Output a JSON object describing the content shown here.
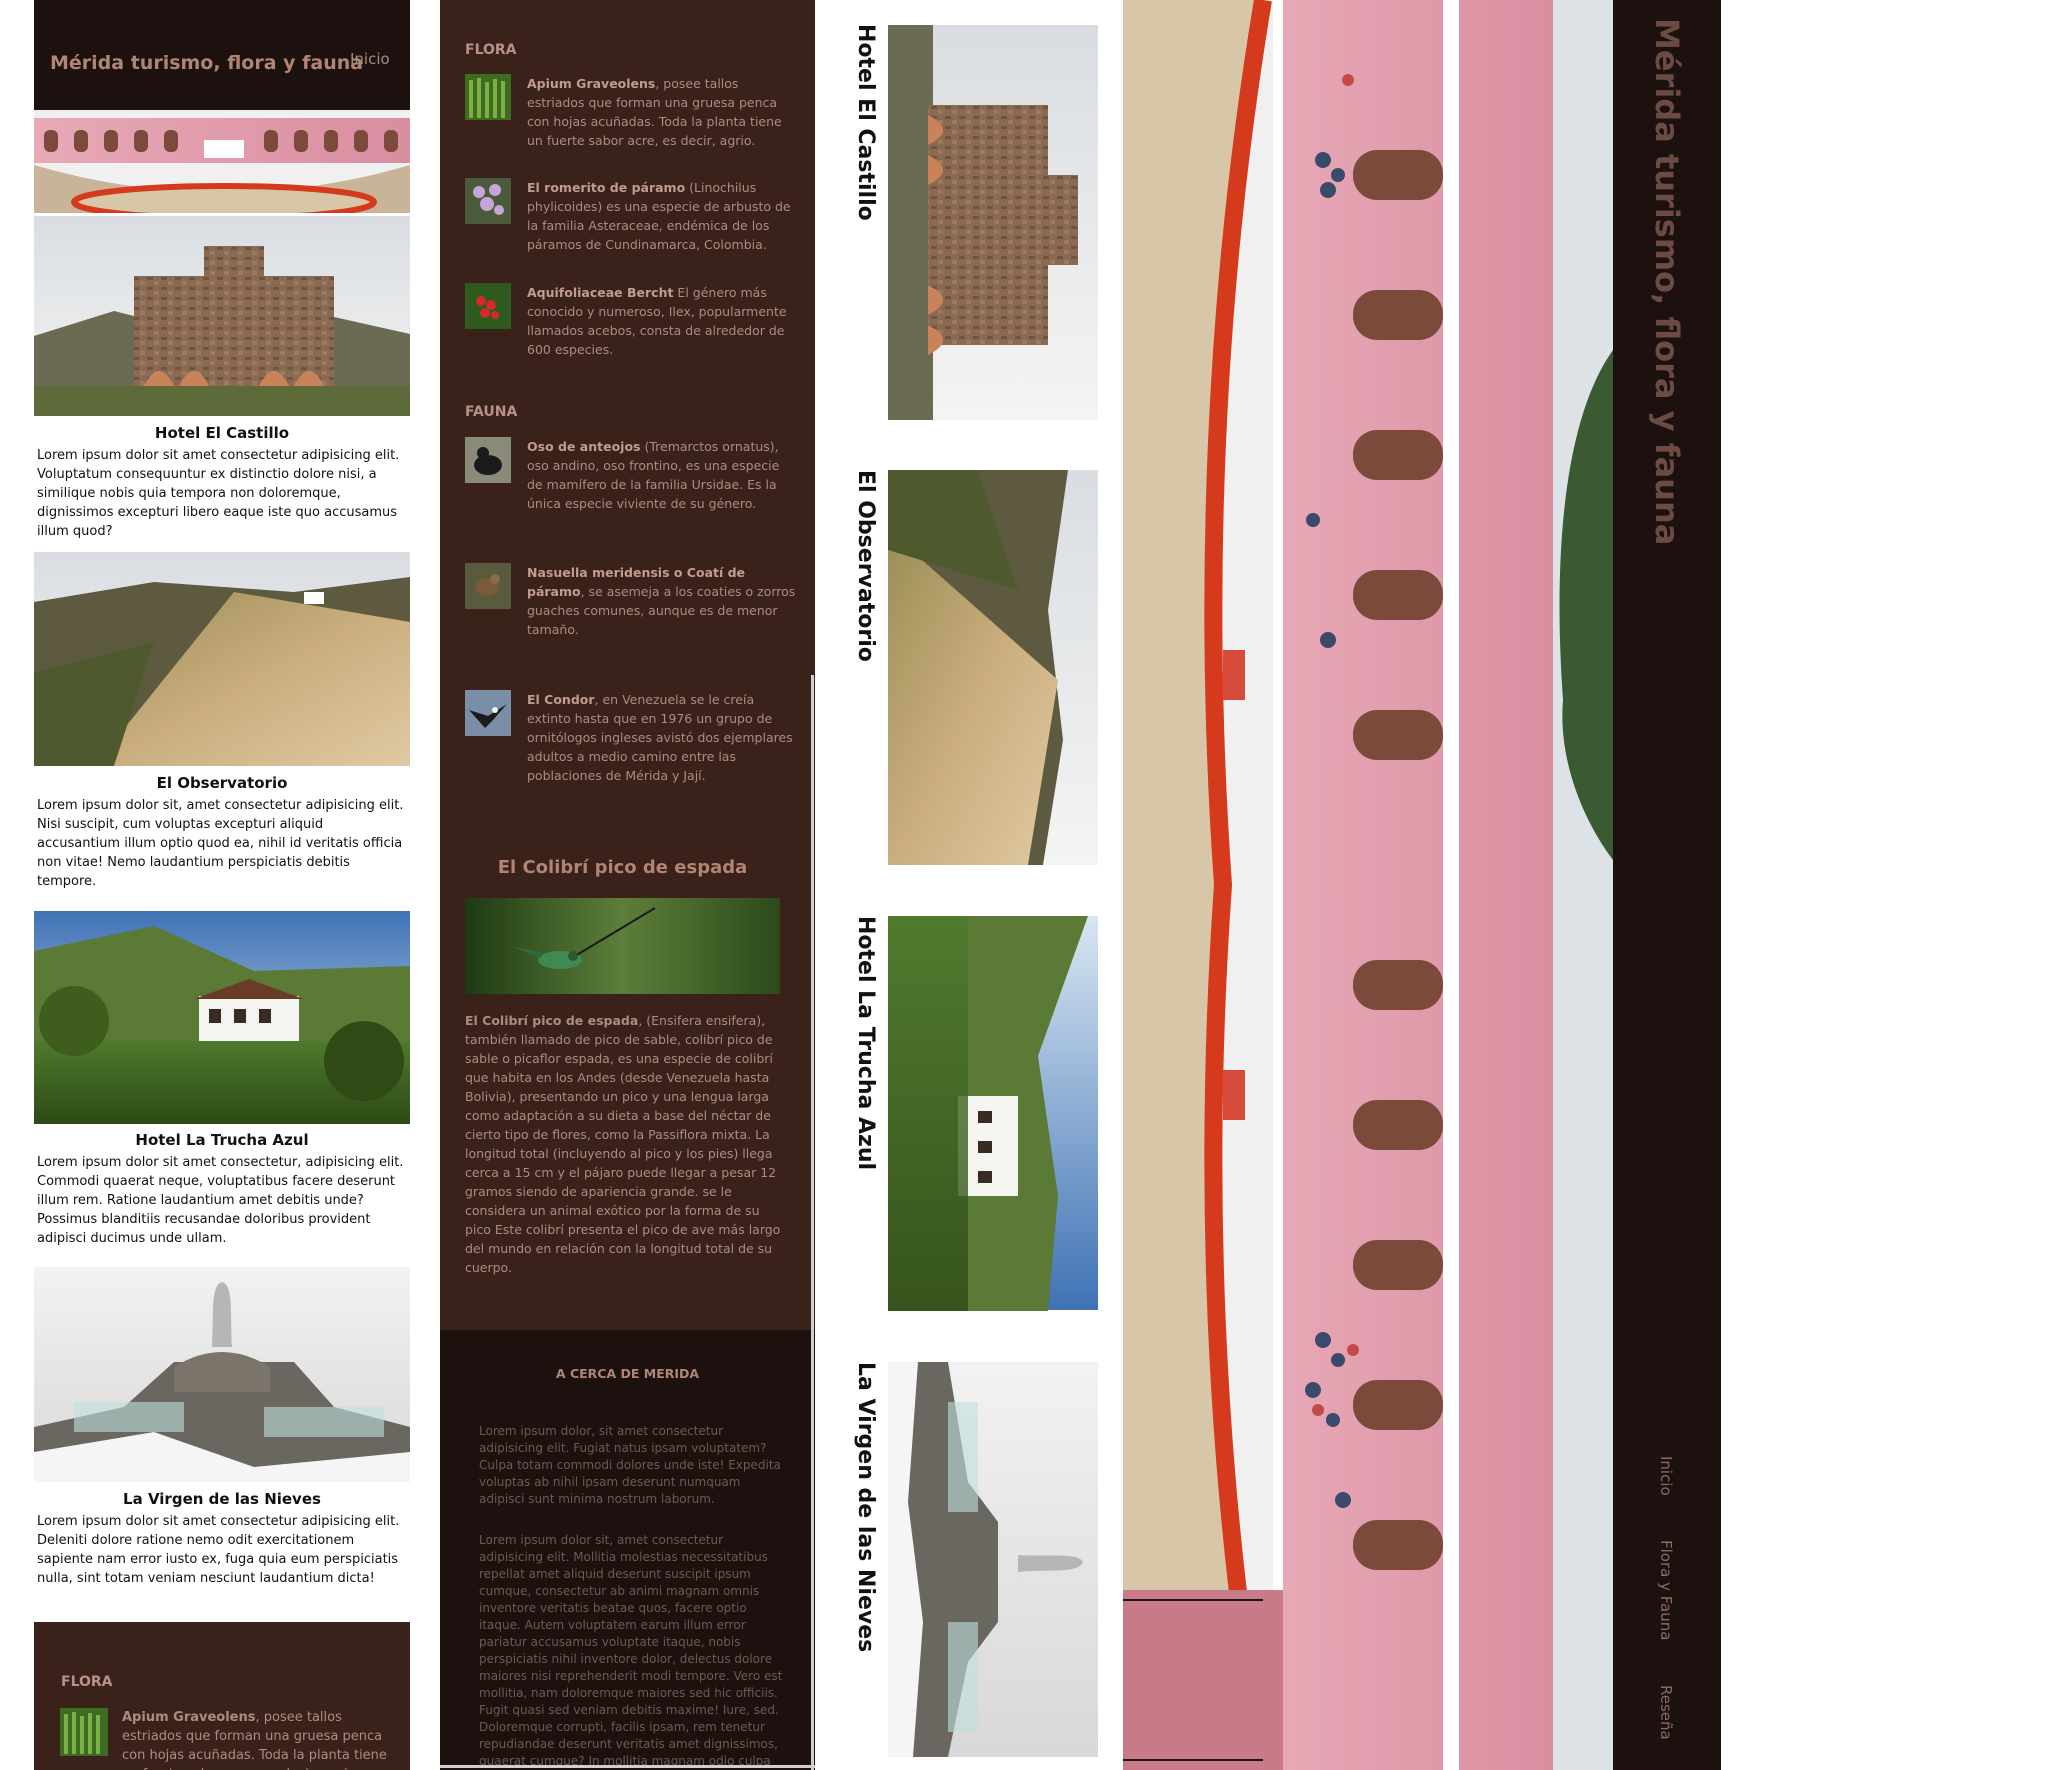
{
  "site_title": "Mérida turismo, flora y fauna",
  "nav": {
    "home": "Inicio",
    "items": [
      "Inicio",
      "Flora y Fauna",
      "Reseña"
    ]
  },
  "hotels": [
    {
      "title": "Hotel El Castillo",
      "text": "Lorem ipsum dolor sit amet consectetur adipisicing elit. Voluptatum consequuntur ex distinctio dolore nisi, a similique nobis quia tempora non doloremque, dignissimos excepturi libero eaque iste quo accusamus illum quod?"
    },
    {
      "title": "El Observatorio",
      "text": "Lorem ipsum dolor sit, amet consectetur adipisicing elit. Nisi suscipit, cum voluptas excepturi aliquid accusantium illum optio quod ea, nihil id veritatis officia non vitae! Nemo laudantium perspiciatis debitis tempore."
    },
    {
      "title": "Hotel La Trucha Azul",
      "text": "Lorem ipsum dolor sit amet consectetur, adipisicing elit. Commodi quaerat neque, voluptatibus facere deserunt illum rem. Ratione laudantium amet debitis unde? Possimus blanditiis recusandae doloribus provident adipisci ducimus unde ullam."
    },
    {
      "title": "La Virgen de las Nieves",
      "text": "Lorem ipsum dolor sit amet consectetur adipisicing elit. Deleniti dolore ratione nemo odit exercitationem sapiente nam error iusto ex, fuga quia eum perspiciatis nulla, sint totam veniam nesciunt laudantium dicta!"
    }
  ],
  "flora": {
    "heading": "FLORA",
    "items": [
      {
        "name": "Apium Graveolens",
        "text": ", posee tallos estriados que forman una gruesa penca con hojas acuñadas. Toda la planta tiene un fuerte sabor acre, es decir, agrio."
      },
      {
        "name": "El romerito de páramo",
        "text": " (Linochilus phylicoides) es una especie de arbusto de la familia Asteraceae, endémica de los páramos de Cundinamarca, Colombia."
      },
      {
        "name": "Aquifoliaceae Bercht",
        "text": " El género más conocido y numeroso, Ilex, popularmente llamados acebos, consta de alrededor de 600 especies."
      }
    ]
  },
  "fauna": {
    "heading": "FAUNA",
    "items": [
      {
        "name": "Oso de anteojos",
        "text": " (Tremarctos ornatus), oso andino, oso frontino, es una especie de mamífero de la familia Ursidae. Es la única especie viviente de su género."
      },
      {
        "name": "Nasuella meridensis o Coatí de páramo",
        "text": ", se asemeja a los coaties o zorros guaches comunes, aunque es de menor tamaño."
      },
      {
        "name": "El Condor",
        "text": ", en Venezuela se le creía extinto hasta que en 1976 un grupo de ornitólogos ingleses avistó dos ejemplares adultos a medio camino entre las poblaciones de Mérida y Jají."
      }
    ]
  },
  "colibri": {
    "title": "El Colibrí pico de espada",
    "name": "El Colibrí pico de espada",
    "text": ", (Ensifera ensifera), también llamado de pico de sable, colibrí pico de sable o picaflor espada, es una especie de colibrí que habita en los Andes (desde Venezuela hasta Bolivia), presentando un pico y una lengua larga como adaptación a su dieta a base del néctar de cierto tipo de flores, como la Passiflora mixta. La longitud total (incluyendo al pico y los pies) llega cerca a 15 cm y el pájaro puede llegar a pesar 12 gramos siendo de apariencia grande. se le considera un animal exótico por la forma de su pico Este colibrí presenta el pico de ave más largo del mundo en relación con la longitud total de su cuerpo."
  },
  "about": {
    "heading": "A CERCA DE MERIDA",
    "p1": "Lorem ipsum dolor, sit amet consectetur adipisicing elit. Fugiat natus ipsam voluptatem? Culpa totam commodi dolores unde iste! Expedita voluptas ab nihil ipsam deserunt numquam adipisci sunt minima nostrum laborum.",
    "p2": "Lorem ipsum dolor sit, amet consectetur adipisicing elit. Mollitia molestias necessitatibus repellat amet aliquid deserunt suscipit ipsum cumque, consectetur ab animi magnam omnis inventore veritatis beatae quos, facere optio itaque. Autem voluptatem earum illum error pariatur accusamus voluptate itaque, nobis perspiciatis nihil inventore dolor, delectus dolore maiores nisi reprehenderit modi tempore. Vero est mollitia, nam doloremque maiores sed hic officiis. Fugit quasi sed veniam debitis maxime! Iure, sed. Doloremque corrupti, facilis ipsam, rem tenetur repudiandae deserunt veritatis amet dignissimos, quaerat cumque? In mollitia magnam odio culpa"
  },
  "colors": {
    "dark_brown": "#3a211a",
    "darkest": "#1c110e",
    "accent_text": "#b08573",
    "muted_text": "#a88e82"
  }
}
